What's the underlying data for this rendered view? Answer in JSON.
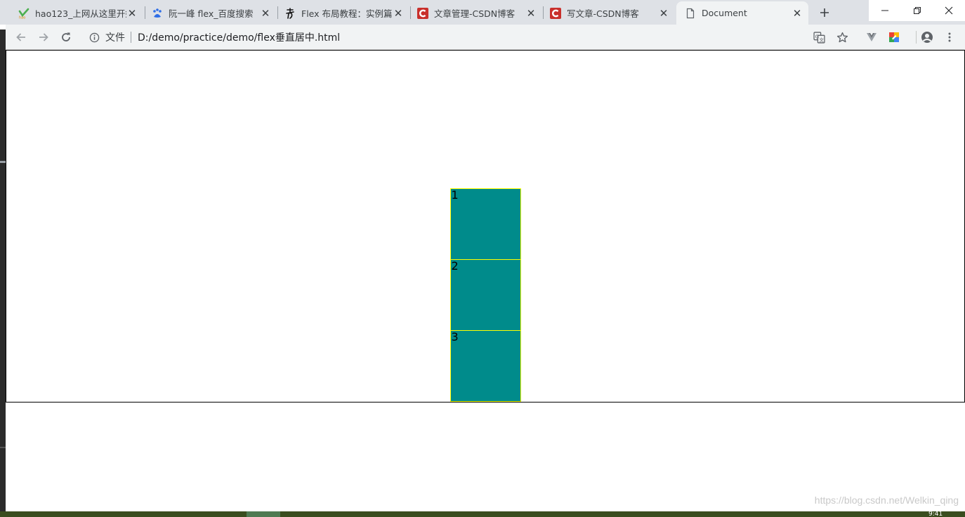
{
  "tabs": [
    {
      "title": "hao123_上网从这里开始",
      "icon": "hao123-icon",
      "active": false
    },
    {
      "title": "阮一峰 flex_百度搜索",
      "icon": "baidu-paw-icon",
      "active": false
    },
    {
      "title": "Flex 布局教程：实例篇",
      "icon": "ruanyf-logo-icon",
      "active": false
    },
    {
      "title": "文章管理-CSDN博客",
      "icon": "csdn-icon",
      "active": false
    },
    {
      "title": "写文章-CSDN博客",
      "icon": "csdn-icon",
      "active": false
    },
    {
      "title": "Document",
      "icon": "document-icon",
      "active": true
    }
  ],
  "toolbar": {
    "file_label": "文件",
    "url": "D:/demo/practice/demo/flex垂直居中.html"
  },
  "page": {
    "boxes": [
      "1",
      "2",
      "3"
    ]
  },
  "watermark": "https://blog.csdn.net/Welkin_qing",
  "taskbar": {
    "clock": "9:41"
  },
  "colors": {
    "box_fill": "#008b8b",
    "box_border": "#ffff00",
    "container_border": "#000000",
    "tab_strip": "#dee1e6",
    "toolbar": "#f1f3f4",
    "csdn_red": "#c9302c"
  }
}
